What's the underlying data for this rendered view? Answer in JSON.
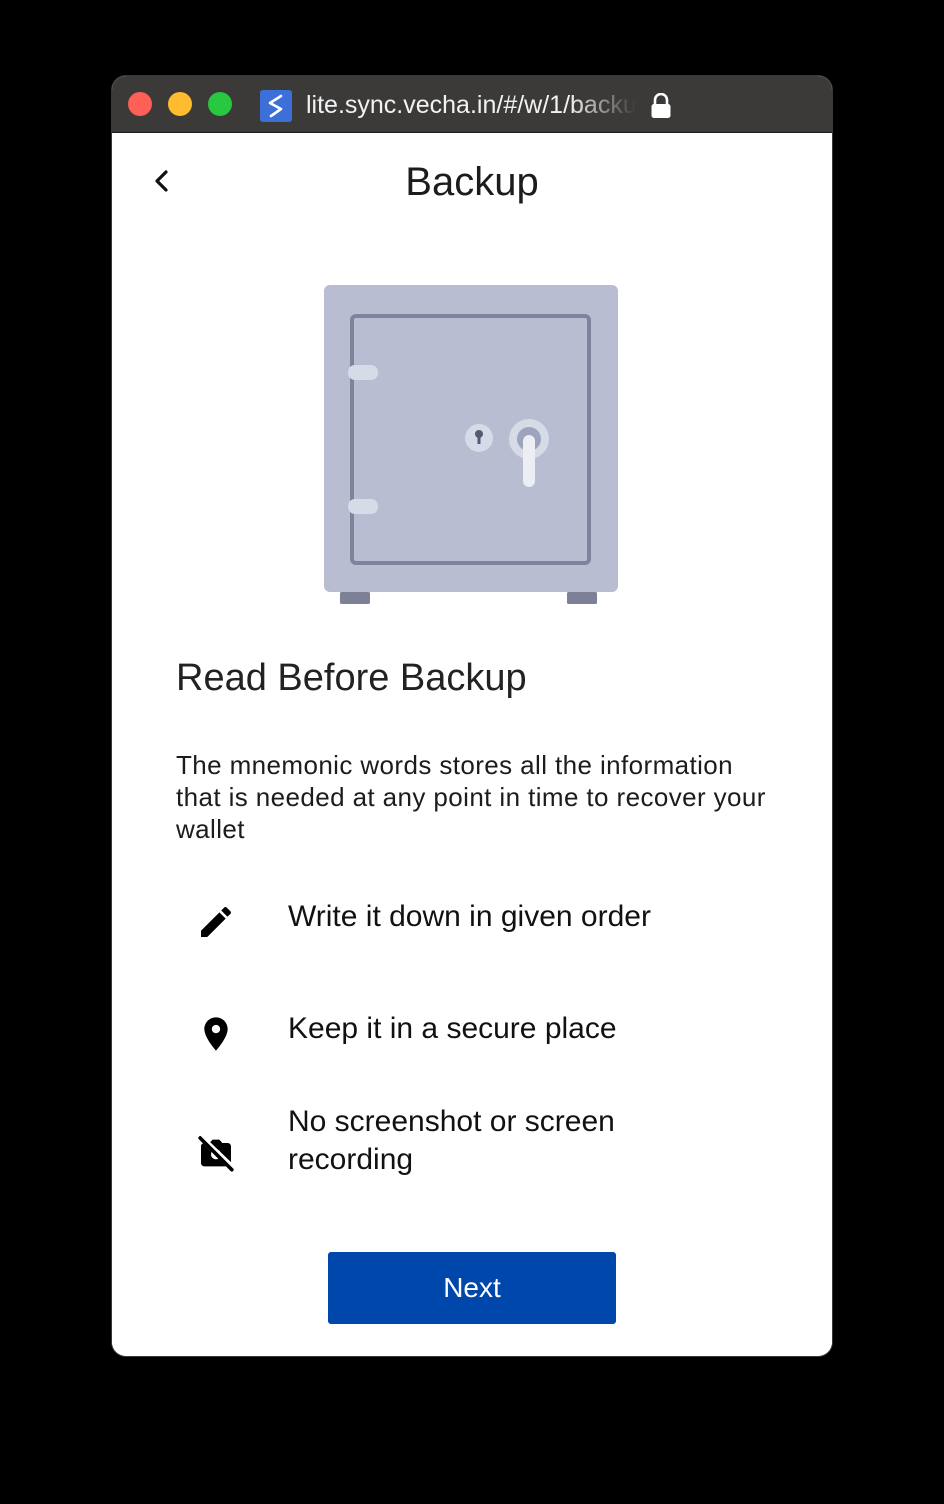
{
  "browser": {
    "url": "lite.sync.vecha.in/#/w/1/backup",
    "site_icon": "sync-icon",
    "lock_icon": "lock-icon"
  },
  "header": {
    "title": "Backup",
    "back_icon": "chevron-left-icon"
  },
  "illustration": {
    "name": "safe-icon",
    "colors": {
      "body": "#b8bdd2",
      "outline": "#7e849e",
      "feet": "#7c8197"
    }
  },
  "content": {
    "section_title": "Read Before Backup",
    "description": "The mnemonic words stores all the information that is needed at any point in time to recover your wallet",
    "tips": [
      {
        "icon": "pencil-icon",
        "text": "Write it down in given order"
      },
      {
        "icon": "location-pin-icon",
        "text": "Keep it in a secure place"
      },
      {
        "icon": "no-camera-icon",
        "text": "No screenshot or screen recording"
      }
    ]
  },
  "footer": {
    "next_label": "Next"
  },
  "colors": {
    "primary": "#0047ab",
    "titlebar": "#3b3a39",
    "background": "#000000"
  }
}
